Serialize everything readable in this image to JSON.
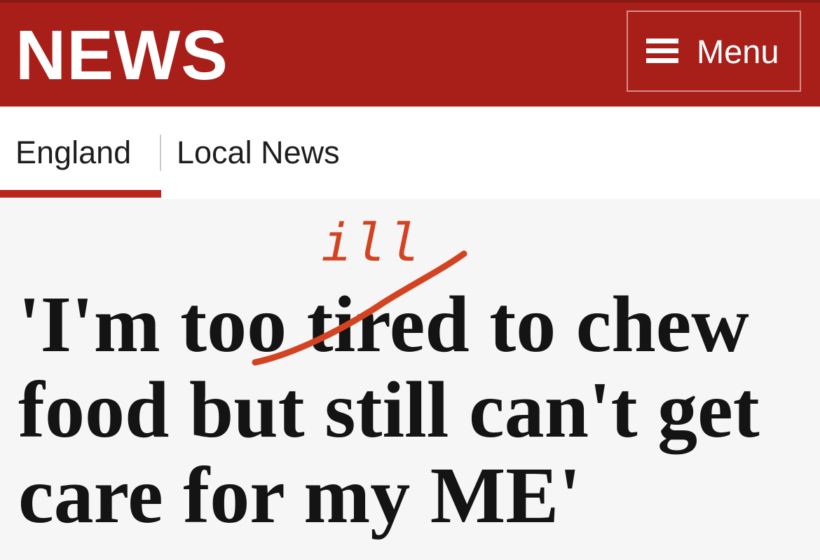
{
  "header": {
    "brand": "NEWS",
    "menu_label": "Menu",
    "menu_icon": "hamburger-icon"
  },
  "subnav": {
    "items": [
      {
        "label": "England",
        "active": true
      },
      {
        "label": "Local News",
        "active": false
      }
    ]
  },
  "article": {
    "headline": "'I'm too tired to chew food but still can't get care for my ME'",
    "annotation_text": "ill"
  },
  "colors": {
    "brand_red": "#a81f1a",
    "accent_underline": "#b8261e",
    "annotation_red": "#d34321"
  }
}
